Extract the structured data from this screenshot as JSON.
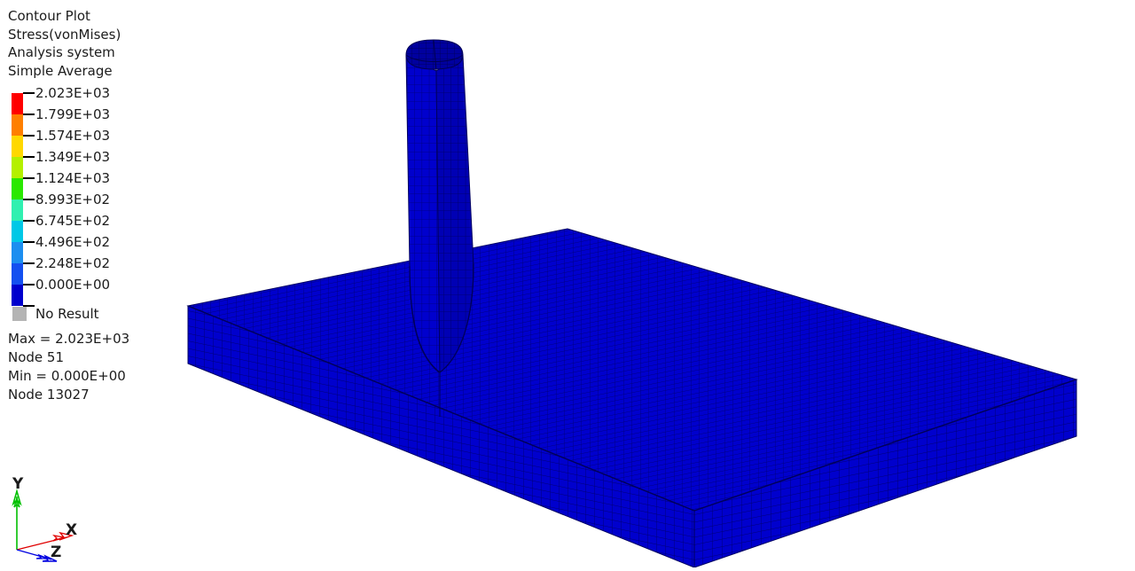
{
  "header": {
    "lines": [
      "Contour Plot",
      "Stress(vonMises)",
      "Analysis system",
      "Simple Average"
    ]
  },
  "legend": {
    "bands": [
      {
        "label": "2.023E+03",
        "color": "#ff0000"
      },
      {
        "label": "1.799E+03",
        "color": "#ff7f00"
      },
      {
        "label": "1.574E+03",
        "color": "#ffd800"
      },
      {
        "label": "1.349E+03",
        "color": "#b4f000"
      },
      {
        "label": "1.124E+03",
        "color": "#2ae800"
      },
      {
        "label": "8.993E+02",
        "color": "#30f0b0"
      },
      {
        "label": "6.745E+02",
        "color": "#00c8e6"
      },
      {
        "label": "4.496E+02",
        "color": "#1c8ef0"
      },
      {
        "label": "2.248E+02",
        "color": "#1450f0"
      },
      {
        "label": "0.000E+00",
        "color": "#0000cd"
      }
    ],
    "no_result_label": "No Result",
    "no_result_color": "#b4b4b4"
  },
  "extremes": {
    "lines": [
      "Max =  2.023E+03",
      "Node 51",
      "Min =  0.000E+00",
      "Node 13027"
    ]
  },
  "axis_triad": {
    "x_label": "X",
    "y_label": "Y",
    "z_label": "Z",
    "x_color": "#e00000",
    "y_color": "#00c000",
    "z_color": "#0000e0"
  },
  "model": {
    "mesh_fill": "#0000cd",
    "mesh_line": "#00008b",
    "description": "meshed plate with vertical rib, von Mises contour, all blue (low stress)"
  },
  "chart_data": {
    "type": "heatmap",
    "title": "Contour Plot Stress(vonMises)",
    "subtitle": "Analysis system / Simple Average",
    "colorbar_values": [
      2023,
      1799,
      1574,
      1349,
      1124,
      899.3,
      674.5,
      449.6,
      224.8,
      0
    ],
    "colorbar_labels": [
      "2.023E+03",
      "1.799E+03",
      "1.574E+03",
      "1.349E+03",
      "1.124E+03",
      "8.993E+02",
      "6.745E+02",
      "4.496E+02",
      "2.248E+02",
      "0.000E+00"
    ],
    "colorbar_colors": [
      "#ff0000",
      "#ff7f00",
      "#ffd800",
      "#b4f000",
      "#2ae800",
      "#30f0b0",
      "#00c8e6",
      "#1c8ef0",
      "#1450f0",
      "#0000cd"
    ],
    "max": 2023,
    "max_node": 51,
    "min": 0,
    "min_node": 13027,
    "units": "",
    "legend_position": "left",
    "grid": false
  }
}
